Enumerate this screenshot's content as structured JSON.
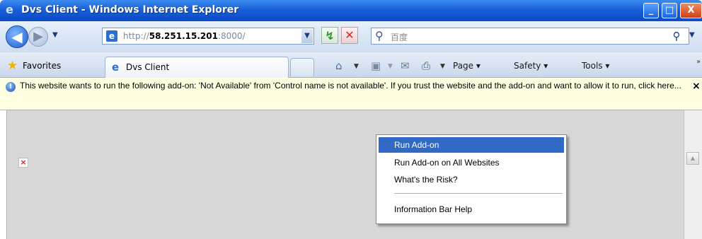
{
  "window": {
    "title": "Dvs Client - Windows Internet Explorer",
    "buttons": {
      "minimize": "_",
      "maximize": "□",
      "close": "X"
    }
  },
  "nav": {
    "address_prefix": "http://",
    "address_host": "58.251.15.201",
    "address_port": ":8000/",
    "search_placeholder": "百度"
  },
  "favorites": {
    "label": "Favorites"
  },
  "tab": {
    "label": "Dvs Client"
  },
  "commands": {
    "page": "Page ▾",
    "safety": "Safety ▾",
    "tools": "Tools ▾"
  },
  "infobar": {
    "message": "This website wants to run the following add-on: 'Not Available' from 'Control name is not available'. If you trust the website and the add-on and want to allow it to run, click here..."
  },
  "context_menu": {
    "items": [
      "Run Add-on",
      "Run Add-on on All Websites",
      "What's the Risk?",
      "Information Bar Help"
    ]
  },
  "colors": {
    "titlebar": "#0a4bc8",
    "infobar_bg": "#ffffe1",
    "menu_highlight": "#316ac5",
    "content_bg": "#d7d7d7"
  },
  "icons": {
    "title": "ie-logo-icon",
    "back": "back-arrow-icon",
    "forward": "forward-arrow-icon",
    "refresh": "refresh-icon",
    "stop": "stop-icon",
    "search": "search-icon",
    "favorites": "star-icon",
    "home": "home-icon",
    "feeds": "rss-icon",
    "mail": "mail-icon",
    "print": "printer-icon",
    "info": "shield-info-icon",
    "broken_image": "broken-image-icon"
  }
}
